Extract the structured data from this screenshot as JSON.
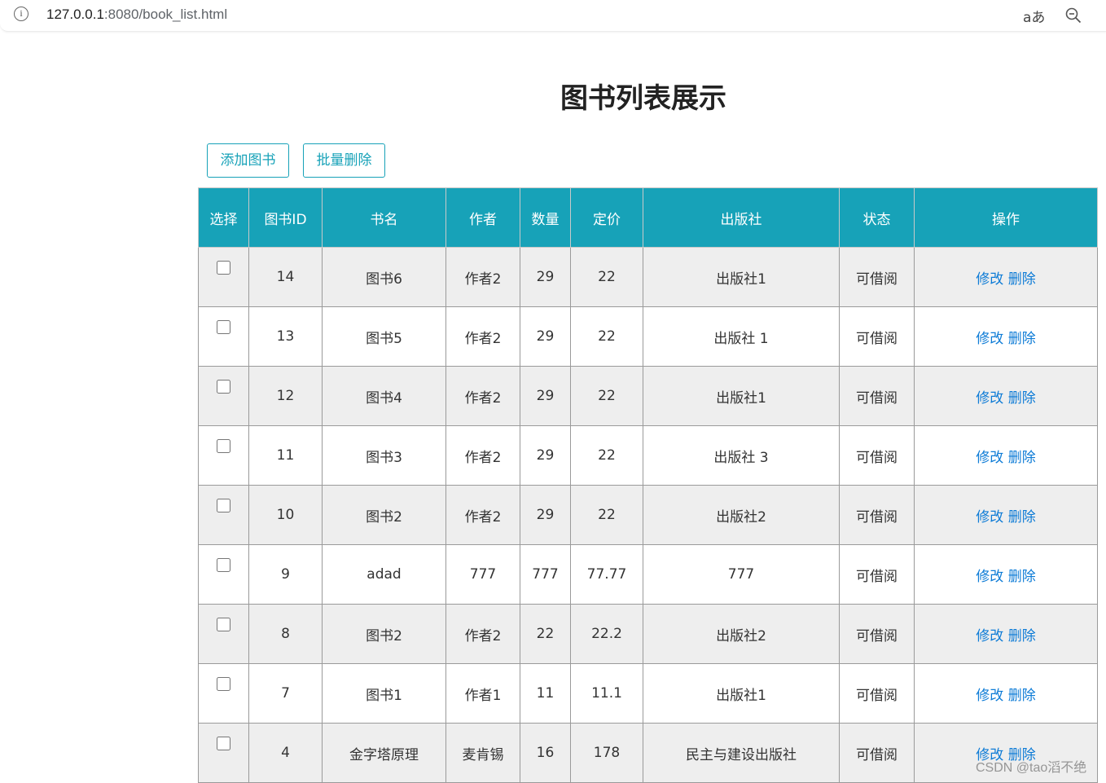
{
  "browser": {
    "url_host": "127.0.0.1",
    "url_path": ":8080/book_list.html",
    "info_icon": "info-icon",
    "read_aloud_glyph": "aあ",
    "zoom_icon": "zoom-out-icon"
  },
  "page": {
    "title": "图书列表展示"
  },
  "toolbar": {
    "add_label": "添加图书",
    "batch_delete_label": "批量删除"
  },
  "table": {
    "headers": [
      "选择",
      "图书ID",
      "书名",
      "作者",
      "数量",
      "定价",
      "出版社",
      "状态",
      "操作"
    ],
    "rows": [
      {
        "id": "14",
        "name": "图书6",
        "author": "作者2",
        "count": "29",
        "price": "22",
        "publisher": "出版社1",
        "status": "可借阅",
        "edit": "修改",
        "delete": "删除"
      },
      {
        "id": "13",
        "name": "图书5",
        "author": "作者2",
        "count": "29",
        "price": "22",
        "publisher": "出版社 1",
        "status": "可借阅",
        "edit": "修改",
        "delete": "删除"
      },
      {
        "id": "12",
        "name": "图书4",
        "author": "作者2",
        "count": "29",
        "price": "22",
        "publisher": "出版社1",
        "status": "可借阅",
        "edit": "修改",
        "delete": "删除"
      },
      {
        "id": "11",
        "name": "图书3",
        "author": "作者2",
        "count": "29",
        "price": "22",
        "publisher": "出版社 3",
        "status": "可借阅",
        "edit": "修改",
        "delete": "删除"
      },
      {
        "id": "10",
        "name": "图书2",
        "author": "作者2",
        "count": "29",
        "price": "22",
        "publisher": "出版社2",
        "status": "可借阅",
        "edit": "修改",
        "delete": "删除"
      },
      {
        "id": "9",
        "name": "adad",
        "author": "777",
        "count": "777",
        "price": "77.77",
        "publisher": "777",
        "status": "可借阅",
        "edit": "修改",
        "delete": "删除"
      },
      {
        "id": "8",
        "name": "图书2",
        "author": "作者2",
        "count": "22",
        "price": "22.2",
        "publisher": "出版社2",
        "status": "可借阅",
        "edit": "修改",
        "delete": "删除"
      },
      {
        "id": "7",
        "name": "图书1",
        "author": "作者1",
        "count": "11",
        "price": "11.1",
        "publisher": "出版社1",
        "status": "可借阅",
        "edit": "修改",
        "delete": "删除"
      },
      {
        "id": "4",
        "name": "金字塔原理",
        "author": "麦肯锡",
        "count": "16",
        "price": "178",
        "publisher": "民主与建设出版社",
        "status": "可借阅",
        "edit": "修改",
        "delete": "删除"
      }
    ]
  },
  "watermark": "CSDN @tao滔不绝",
  "colors": {
    "header_bg": "#17a2b8",
    "link": "#0d7bd6",
    "row_alt": "#eeeeee"
  }
}
